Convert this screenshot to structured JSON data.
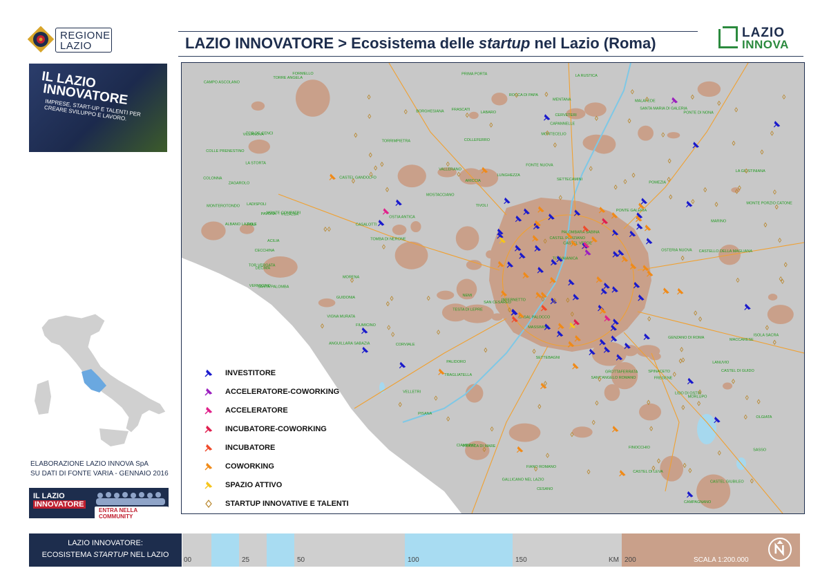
{
  "header": {
    "region_logo_line1": "REGIONE",
    "region_logo_line2": "LAZIO",
    "title_prefix": "LAZIO INNOVATORE > Ecosistema delle ",
    "title_italic": "startup",
    "title_suffix": " nel Lazio (Roma)",
    "brand_line1": "LAZIO",
    "brand_line2": "INNOVA"
  },
  "photo": {
    "line1": "IL LAZIO",
    "line2": "INNOVATORE",
    "line3": "IMPRESE, START-UP E TALENTI PER CREARE SVILUPPO E LAVORO."
  },
  "credit": {
    "line1": "ELABORAZIONE LAZIO INNOVA SpA",
    "line2": "SU DATI DI FONTE VARIA - GENNAIO 2016"
  },
  "community": {
    "line1": "IL LAZIO",
    "line2": "INNOVATORE",
    "button": "ENTRA NELLA COMMUNITY"
  },
  "legend": {
    "items": [
      {
        "label": "INVESTITORE",
        "color": "#1a1acc",
        "icon": "pin-icon"
      },
      {
        "label": "ACCELERATORE-COWORKING",
        "color": "#9b1fbf",
        "icon": "pin-icon"
      },
      {
        "label": "ACCELERATORE",
        "color": "#e0208a",
        "icon": "pin-icon"
      },
      {
        "label": "INCUBATORE-COWORKING",
        "color": "#e01f4f",
        "icon": "pin-icon"
      },
      {
        "label": "INCUBATORE",
        "color": "#f04a2a",
        "icon": "pin-icon"
      },
      {
        "label": "COWORKING",
        "color": "#f08a18",
        "icon": "pin-icon"
      },
      {
        "label": "SPAZIO ATTIVO",
        "color": "#f6c51a",
        "icon": "pin-icon"
      },
      {
        "label": "STARTUP INNOVATIVE E TALENTI",
        "color": "#b8862b",
        "icon": "diamond-icon"
      }
    ]
  },
  "map": {
    "colors": {
      "territory": "#c8c8c8",
      "urban": "#c9a08a",
      "water": "#a6d8ee",
      "roads": "#f0a030",
      "place_labels": "#1f9a1f"
    },
    "place_labels": [
      "ANGUILLARA SABAZIA",
      "CASTEL GIUBILEO",
      "OSTERIA NUOVA",
      "LA STORTA",
      "CESANO",
      "CASALOTTI",
      "TORRIMPIETRA",
      "MACCARESE",
      "FREGENE",
      "FIUMICINO",
      "ISOLA SACRA",
      "OSTIA ANTICA",
      "CASAL PALOCCO",
      "ACILIA",
      "LIDO DI OSTIA",
      "INFERNETTO",
      "CASTEL PORZIANO",
      "TOR DE CENCI",
      "CASTEL DI LEVA",
      "CIAMPINO",
      "FRASCATI",
      "MARINO",
      "CASTEL GANDOLFO",
      "ALBANO LAZIALE",
      "GENZANO DI ROMA",
      "ROCCA DI PAPA",
      "COLLEFERRO",
      "TIVOLI",
      "GUIDONIA",
      "FONTE NUOVA",
      "SETTEBAGNI",
      "LABARO",
      "PRIMA PORTA",
      "CERVETERI",
      "LADISPOLI",
      "PALIDORO",
      "SASSO",
      "FORMELLO",
      "CAMPAGNANO",
      "MORLUPO",
      "FIANO ROMANO",
      "MONTEROTONDO",
      "MENTANA",
      "PALOMBARA SABINA",
      "MONTECELIO",
      "SANT'ANGELO ROMANO",
      "COLONNA",
      "MONTE COMPATRI",
      "ZAGAROLO",
      "SAN CESAREO",
      "GALLICANO NEL LAZIO",
      "POLI",
      "VILLANOVA",
      "VILLALBA",
      "PAVONA",
      "CECCHINA",
      "NEMI",
      "LANUVIO",
      "VELLETRI",
      "ARICCIA",
      "POMEZIA",
      "TORVAIANICA",
      "PRATICA DI MARE",
      "SANTA PALOMBA",
      "VALLERANO",
      "SPINACETO",
      "DECIMA",
      "MALAFEDE",
      "MOSTACCIANO",
      "PONTE GALERIA",
      "TESTA DI LEPRE",
      "TRAGLIATELLA",
      "SANTA MARIA DI GALERIA",
      "OLGIATA",
      "LA GIUSTINIANA",
      "TOMBA DI NERONE",
      "CASTEL DI GUIDO",
      "CASTELLO DELLA MAGLIANA",
      "PISANA",
      "MASSIMINA",
      "CORVIALE",
      "TOR VERGATA",
      "BORGHESIANA",
      "LUNGHEZZA",
      "SETTECAMINI",
      "CASTEL VERDE",
      "PONTE DI NONA",
      "TORRE ANGELA",
      "FINOCCHIO",
      "LA RUSTICA",
      "COLLE PRENESTINO",
      "CAMPO ASCOLANO",
      "VIGNA MURATA",
      "CAPANNELLE",
      "MORENA",
      "VERMICINO",
      "GROTTAFERRATA",
      "MONTE PORZIO CATONE"
    ],
    "scale_label": "SCALA 1:200.000"
  },
  "footer": {
    "title_line1": "LAZIO INNOVATORE:",
    "title_line2_prefix": "ECOSISTEMA ",
    "title_line2_italic": "STARTUP",
    "title_line2_suffix": " NEL LAZIO",
    "ticks": [
      "00",
      "25",
      "50",
      "100",
      "150",
      "KM",
      "200"
    ],
    "scale_text": "SCALA 1:200.000"
  }
}
